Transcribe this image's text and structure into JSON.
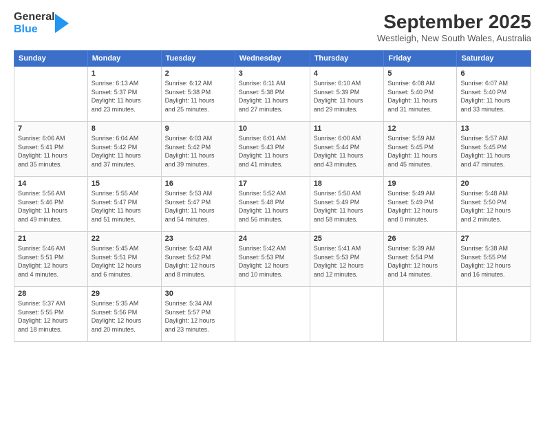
{
  "logo": {
    "line1": "General",
    "line2": "Blue"
  },
  "title": "September 2025",
  "location": "Westleigh, New South Wales, Australia",
  "headers": [
    "Sunday",
    "Monday",
    "Tuesday",
    "Wednesday",
    "Thursday",
    "Friday",
    "Saturday"
  ],
  "weeks": [
    [
      {
        "day": "",
        "info": ""
      },
      {
        "day": "1",
        "info": "Sunrise: 6:13 AM\nSunset: 5:37 PM\nDaylight: 11 hours\nand 23 minutes."
      },
      {
        "day": "2",
        "info": "Sunrise: 6:12 AM\nSunset: 5:38 PM\nDaylight: 11 hours\nand 25 minutes."
      },
      {
        "day": "3",
        "info": "Sunrise: 6:11 AM\nSunset: 5:38 PM\nDaylight: 11 hours\nand 27 minutes."
      },
      {
        "day": "4",
        "info": "Sunrise: 6:10 AM\nSunset: 5:39 PM\nDaylight: 11 hours\nand 29 minutes."
      },
      {
        "day": "5",
        "info": "Sunrise: 6:08 AM\nSunset: 5:40 PM\nDaylight: 11 hours\nand 31 minutes."
      },
      {
        "day": "6",
        "info": "Sunrise: 6:07 AM\nSunset: 5:40 PM\nDaylight: 11 hours\nand 33 minutes."
      }
    ],
    [
      {
        "day": "7",
        "info": "Sunrise: 6:06 AM\nSunset: 5:41 PM\nDaylight: 11 hours\nand 35 minutes."
      },
      {
        "day": "8",
        "info": "Sunrise: 6:04 AM\nSunset: 5:42 PM\nDaylight: 11 hours\nand 37 minutes."
      },
      {
        "day": "9",
        "info": "Sunrise: 6:03 AM\nSunset: 5:42 PM\nDaylight: 11 hours\nand 39 minutes."
      },
      {
        "day": "10",
        "info": "Sunrise: 6:01 AM\nSunset: 5:43 PM\nDaylight: 11 hours\nand 41 minutes."
      },
      {
        "day": "11",
        "info": "Sunrise: 6:00 AM\nSunset: 5:44 PM\nDaylight: 11 hours\nand 43 minutes."
      },
      {
        "day": "12",
        "info": "Sunrise: 5:59 AM\nSunset: 5:45 PM\nDaylight: 11 hours\nand 45 minutes."
      },
      {
        "day": "13",
        "info": "Sunrise: 5:57 AM\nSunset: 5:45 PM\nDaylight: 11 hours\nand 47 minutes."
      }
    ],
    [
      {
        "day": "14",
        "info": "Sunrise: 5:56 AM\nSunset: 5:46 PM\nDaylight: 11 hours\nand 49 minutes."
      },
      {
        "day": "15",
        "info": "Sunrise: 5:55 AM\nSunset: 5:47 PM\nDaylight: 11 hours\nand 51 minutes."
      },
      {
        "day": "16",
        "info": "Sunrise: 5:53 AM\nSunset: 5:47 PM\nDaylight: 11 hours\nand 54 minutes."
      },
      {
        "day": "17",
        "info": "Sunrise: 5:52 AM\nSunset: 5:48 PM\nDaylight: 11 hours\nand 56 minutes."
      },
      {
        "day": "18",
        "info": "Sunrise: 5:50 AM\nSunset: 5:49 PM\nDaylight: 11 hours\nand 58 minutes."
      },
      {
        "day": "19",
        "info": "Sunrise: 5:49 AM\nSunset: 5:49 PM\nDaylight: 12 hours\nand 0 minutes."
      },
      {
        "day": "20",
        "info": "Sunrise: 5:48 AM\nSunset: 5:50 PM\nDaylight: 12 hours\nand 2 minutes."
      }
    ],
    [
      {
        "day": "21",
        "info": "Sunrise: 5:46 AM\nSunset: 5:51 PM\nDaylight: 12 hours\nand 4 minutes."
      },
      {
        "day": "22",
        "info": "Sunrise: 5:45 AM\nSunset: 5:51 PM\nDaylight: 12 hours\nand 6 minutes."
      },
      {
        "day": "23",
        "info": "Sunrise: 5:43 AM\nSunset: 5:52 PM\nDaylight: 12 hours\nand 8 minutes."
      },
      {
        "day": "24",
        "info": "Sunrise: 5:42 AM\nSunset: 5:53 PM\nDaylight: 12 hours\nand 10 minutes."
      },
      {
        "day": "25",
        "info": "Sunrise: 5:41 AM\nSunset: 5:53 PM\nDaylight: 12 hours\nand 12 minutes."
      },
      {
        "day": "26",
        "info": "Sunrise: 5:39 AM\nSunset: 5:54 PM\nDaylight: 12 hours\nand 14 minutes."
      },
      {
        "day": "27",
        "info": "Sunrise: 5:38 AM\nSunset: 5:55 PM\nDaylight: 12 hours\nand 16 minutes."
      }
    ],
    [
      {
        "day": "28",
        "info": "Sunrise: 5:37 AM\nSunset: 5:55 PM\nDaylight: 12 hours\nand 18 minutes."
      },
      {
        "day": "29",
        "info": "Sunrise: 5:35 AM\nSunset: 5:56 PM\nDaylight: 12 hours\nand 20 minutes."
      },
      {
        "day": "30",
        "info": "Sunrise: 5:34 AM\nSunset: 5:57 PM\nDaylight: 12 hours\nand 23 minutes."
      },
      {
        "day": "",
        "info": ""
      },
      {
        "day": "",
        "info": ""
      },
      {
        "day": "",
        "info": ""
      },
      {
        "day": "",
        "info": ""
      }
    ]
  ]
}
